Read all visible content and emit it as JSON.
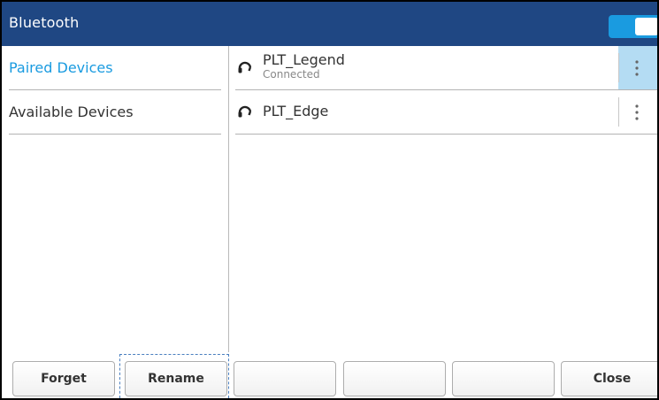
{
  "header": {
    "title": "Bluetooth",
    "bluetooth_enabled": true
  },
  "left_menu": {
    "items": [
      {
        "label": "Paired Devices",
        "selected": true
      },
      {
        "label": "Available Devices",
        "selected": false
      }
    ]
  },
  "devices": [
    {
      "name": "PLT_Legend",
      "status": "Connected",
      "icon": "headset-icon",
      "menu_icon": "more-vertical-icon"
    },
    {
      "name": "PLT_Edge",
      "status": "",
      "icon": "headset-icon",
      "menu_icon": "more-vertical-icon"
    }
  ],
  "softkeys": [
    {
      "label": "Forget"
    },
    {
      "label": "Rename"
    },
    {
      "label": ""
    },
    {
      "label": ""
    },
    {
      "label": ""
    },
    {
      "label": "Close"
    }
  ],
  "colors": {
    "header_bg": "#1f4783",
    "accent": "#1a9be0",
    "selection_bg": "#b4dcf3"
  }
}
